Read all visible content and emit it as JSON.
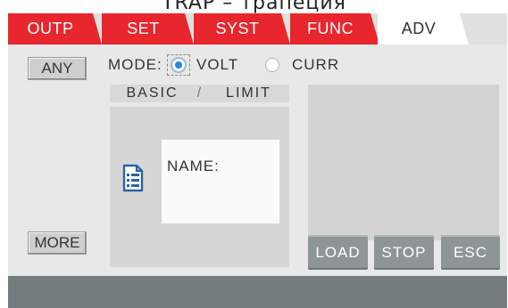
{
  "caption": "TRAP – трапеция",
  "tabs": [
    {
      "label": "OUTP"
    },
    {
      "label": "SET"
    },
    {
      "label": "SYST"
    },
    {
      "label": "FUNC"
    },
    {
      "label": "ADV"
    }
  ],
  "active_tab": "ADV",
  "left_buttons": {
    "any": "ANY",
    "more": "MORE"
  },
  "mode": {
    "label": "MODE:",
    "options": [
      {
        "label": "VOLT",
        "selected": true
      },
      {
        "label": "CURR",
        "selected": false
      }
    ]
  },
  "subtabs": {
    "basic": "BASIC",
    "separator": "/",
    "limit": "LIMIT"
  },
  "content": {
    "name_label": "NAME:",
    "icon": "document-list-icon"
  },
  "actions": {
    "load": "LOAD",
    "stop": "STOP",
    "esc": "ESC"
  },
  "colors": {
    "tab_red": "#e8262d",
    "accent_blue": "#1e88e5",
    "button_gray": "#8e9596",
    "footer": "#737b7d"
  }
}
